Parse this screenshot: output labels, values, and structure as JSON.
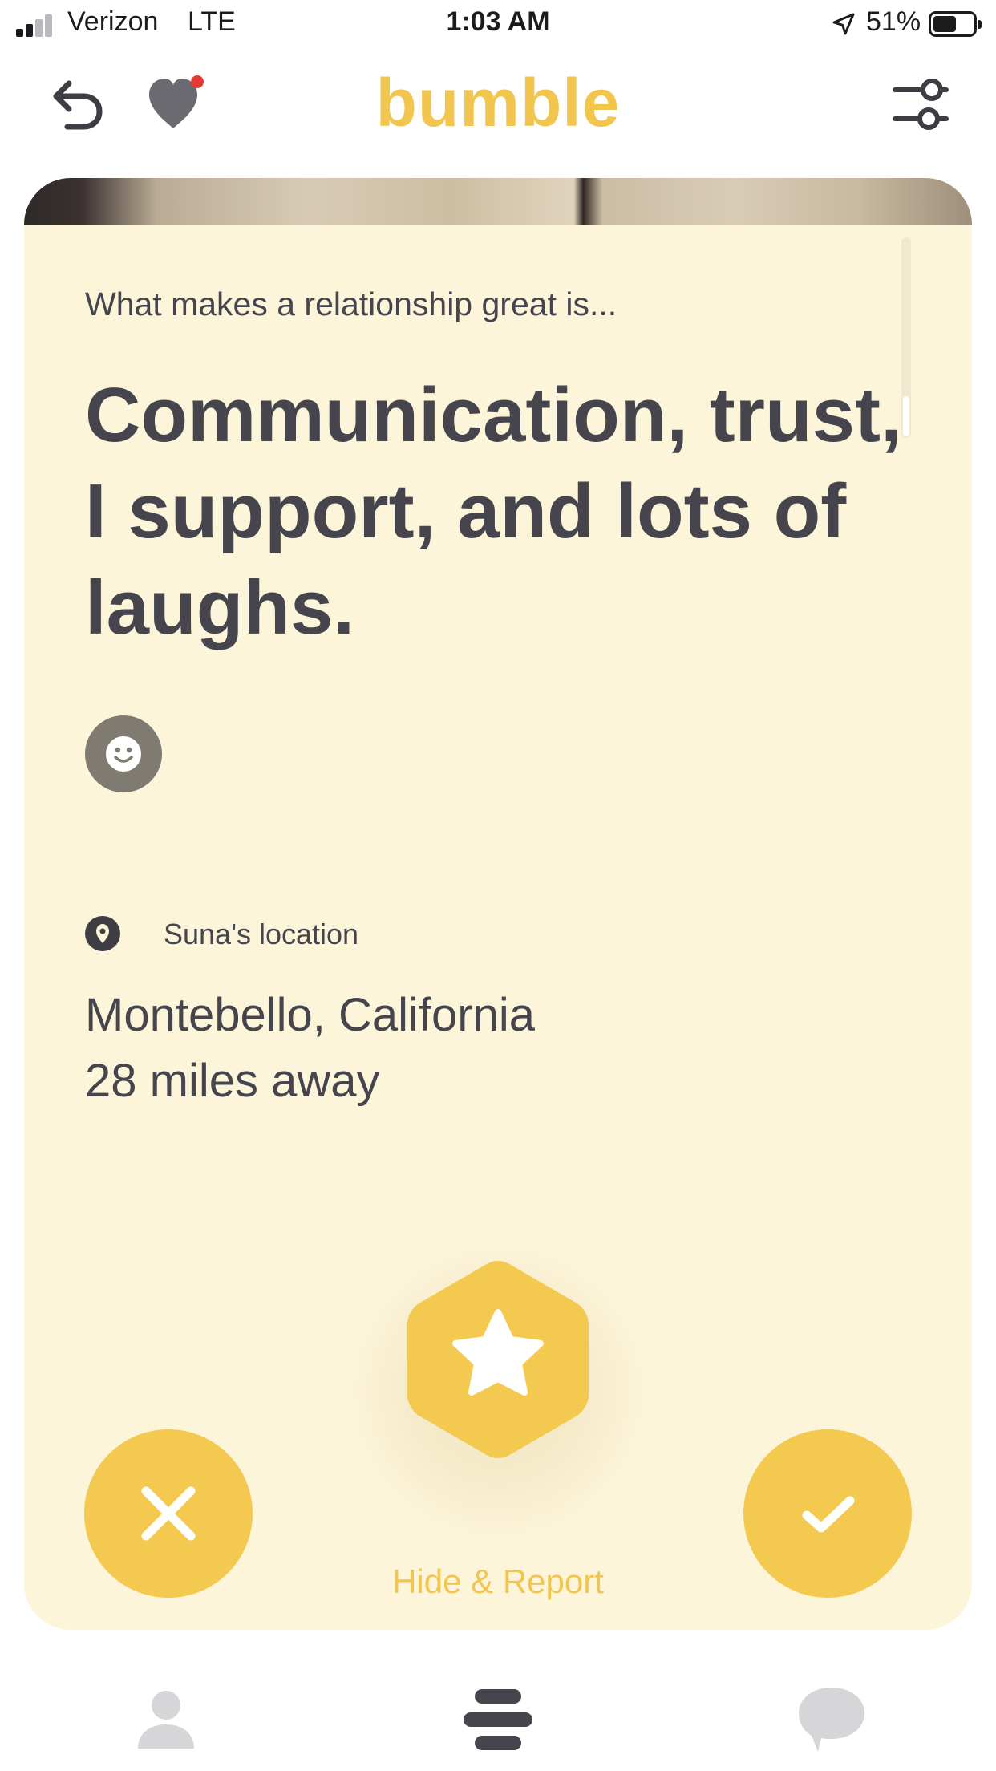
{
  "status_bar": {
    "carrier": "Verizon",
    "network": "LTE",
    "time": "1:03 AM",
    "battery_percent": "51%",
    "battery_level": 0.51,
    "signal_bars": 2
  },
  "app_bar": {
    "brand": "bumble",
    "brand_color": "#f2c64e",
    "notification_dot_color": "#e53935",
    "icons": [
      "undo-icon",
      "heart-icon",
      "filter-icon"
    ]
  },
  "profile": {
    "prompt_question": "What makes a relationship great is...",
    "prompt_answer": "Communication, trust, I support, and lots of laughs.",
    "reaction_icon": "smiley-icon",
    "location_label": "Suna's location",
    "location_city": "Montebello, California",
    "location_distance": "28 miles away"
  },
  "actions": {
    "pass_icon": "x-icon",
    "superswipe_icon": "star-icon",
    "like_icon": "check-icon",
    "hide_report_label": "Hide & Report",
    "accent_color": "#f4c950"
  },
  "tab_bar": {
    "tabs": [
      "profile-icon",
      "people-icon",
      "chat-icon"
    ],
    "active_tab": "people-icon"
  },
  "colors": {
    "card_background": "#fdf5da",
    "text_color": "#46454d"
  }
}
